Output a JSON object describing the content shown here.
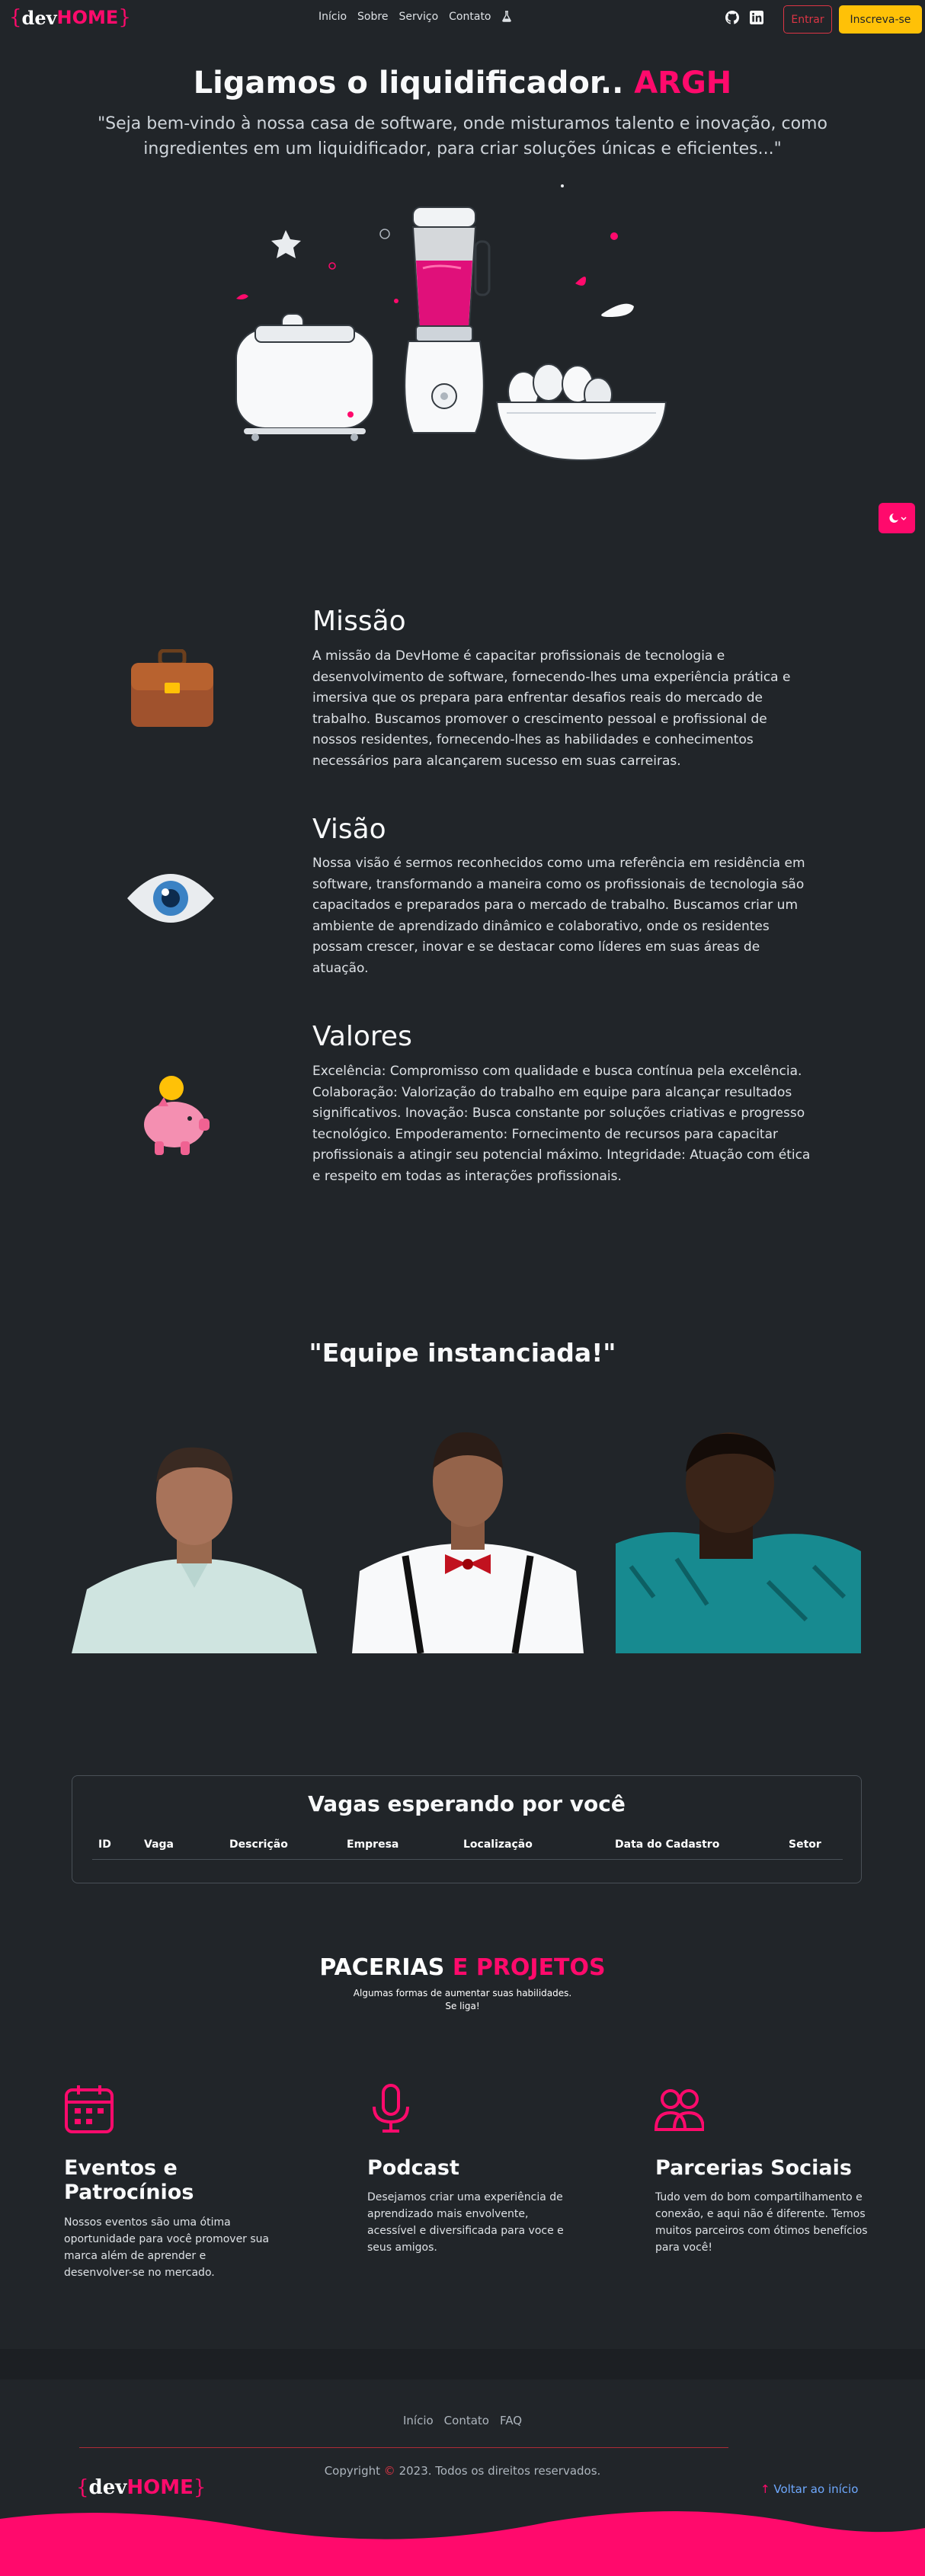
{
  "nav": {
    "brand_dev": "dev",
    "brand_home": "HOME",
    "links": [
      "Início",
      "Sobre",
      "Serviço",
      "Contato"
    ],
    "login_label": "Entrar",
    "signup_label": "Inscreva-se",
    "icons": [
      "flask-icon",
      "github-icon",
      "linkedin-icon"
    ]
  },
  "hero": {
    "title": "Ligamos o liquidificador..",
    "title_accent": "ARGH",
    "quote": "\"Seja bem-vindo à nossa casa de software, onde misturamos talento e inovação, como ingredientes em um liquidificador, para criar soluções únicas e eficientes...\""
  },
  "mission": {
    "title": "Missão",
    "text": "A missão da DevHome é capacitar profissionais de tecnologia e desenvolvimento de software, fornecendo-lhes uma experiência prática e imersiva que os prepara para enfrentar desafios reais do mercado de trabalho. Buscamos promover o crescimento pessoal e profissional de nossos residentes, fornecendo-lhes as habilidades e conhecimentos necessários para alcançarem sucesso em suas carreiras."
  },
  "vision": {
    "title": "Visão",
    "text": "Nossa visão é sermos reconhecidos como uma referência em residência em software, transformando a maneira como os profissionais de tecnologia são capacitados e preparados para o mercado de trabalho. Buscamos criar um ambiente de aprendizado dinâmico e colaborativo, onde os residentes possam crescer, inovar e se destacar como líderes em suas áreas de atuação."
  },
  "values": {
    "title": "Valores",
    "text": "Excelência: Compromisso com qualidade e busca contínua pela excelência. Colaboração: Valorização do trabalho em equipe para alcançar resultados significativos. Inovação: Busca constante por soluções criativas e progresso tecnológico. Empoderamento: Fornecimento de recursos para capacitar profissionais a atingir seu potencial máximo. Integridade: Atuação com ética e respeito em todas as interações profissionais."
  },
  "team": {
    "title": "\"Equipe instanciada!\""
  },
  "jobs": {
    "title": "Vagas esperando por você",
    "columns": [
      "ID",
      "Vaga",
      "Descrição",
      "Empresa",
      "Localização",
      "Data do Cadastro",
      "Setor"
    ]
  },
  "partners": {
    "title": "PACERIAS",
    "title_accent": "E PROJETOS",
    "subtitle_line1": "Algumas formas de aumentar suas habilidades.",
    "subtitle_line2": "Se liga!",
    "features": [
      {
        "icon": "calendar-icon",
        "title": "Eventos e Patrocínios",
        "text": "Nossos eventos são uma ótima oportunidade para você promover sua marca além de aprender e desenvolver-se no mercado."
      },
      {
        "icon": "microphone-icon",
        "title": "Podcast",
        "text": "Desejamos criar uma experiência de aprendizado mais envolvente, acessível e diversificada para voce e seus amigos."
      },
      {
        "icon": "people-icon",
        "title": "Parcerias Sociais",
        "text": "Tudo vem do bom compartilhamento e conexão, e aqui não é diferente. Temos muitos parceiros com ótimos benefícios para você!"
      }
    ]
  },
  "footer": {
    "links": [
      "Início",
      "Contato",
      "FAQ"
    ],
    "copyright_prefix": "Copyright",
    "copyright_symbol": "©",
    "copyright_suffix": "2023. Todos os direitos reservados.",
    "back_to_top": "Voltar ao início"
  },
  "colors": {
    "background": "#212529",
    "accent": "#ff0a6c",
    "warning": "#ffc107",
    "danger": "#dc3545",
    "link": "#6ea8fe"
  }
}
